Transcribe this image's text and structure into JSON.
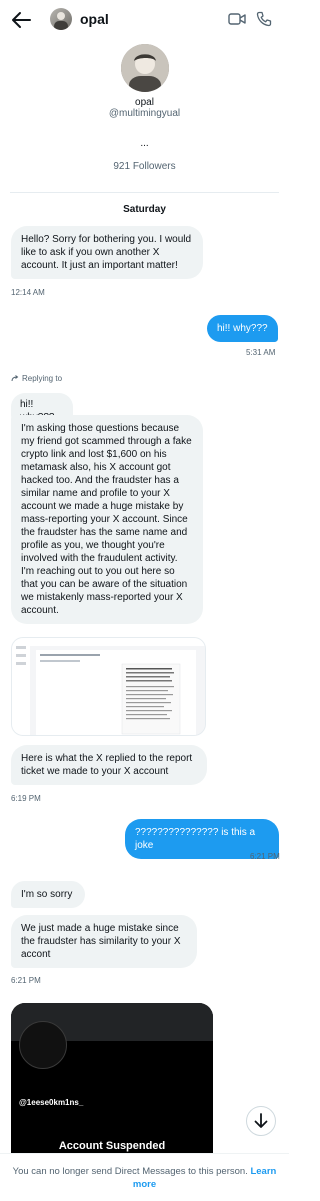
{
  "header": {
    "name": "opal",
    "back_icon": "arrow-left-icon",
    "video_icon": "video-camera-icon",
    "call_icon": "phone-icon"
  },
  "profile": {
    "name": "opal",
    "handle": "@multimingyual",
    "dots": "...",
    "followers": "921 Followers"
  },
  "date_label": "Saturday",
  "messages": [
    {
      "text": "Hello? Sorry for bothering you. I would like to ask if you own another X account. It just an important matter!",
      "time": "12:14 AM"
    },
    {
      "text": "hi!! why???",
      "time": "5:31 AM"
    },
    {
      "reply_label": "Replying to",
      "quoted": "hi!! why???",
      "text": "I'm asking those questions because my friend got scammed through a fake crypto link and lost $1,600 on his metamask also, his X account got hacked too. And the fraudster has a similar name and profile to your X account we made a huge mistake by mass-reporting your X account. Since the fraudster has the same name and profile as you, we thought you're involved with the fraudulent activity. I'm reaching out to you out here so that you can be aware of the situation we mistakenly mass-reported your X account."
    },
    {
      "text": "Here is what the X replied to the report ticket we made to your X account",
      "time": "6:19 PM"
    },
    {
      "text": "??????????????? is this a joke",
      "time": "6:21 PM"
    },
    {
      "text": "I'm so sorry"
    },
    {
      "text": "We just made a huge mistake since the fraudster has similarity to your X accont",
      "time": "6:21 PM"
    }
  ],
  "media": {
    "handle": "@1eese0km1ns_",
    "title": "Account Suspended"
  },
  "footer": {
    "text": "You can no longer send Direct Messages to this person.",
    "link": "Learn more"
  },
  "colors": {
    "accent": "#1d9bf0",
    "bubble_in": "#eff3f4",
    "text": "#0f1419",
    "muted": "#536471"
  }
}
